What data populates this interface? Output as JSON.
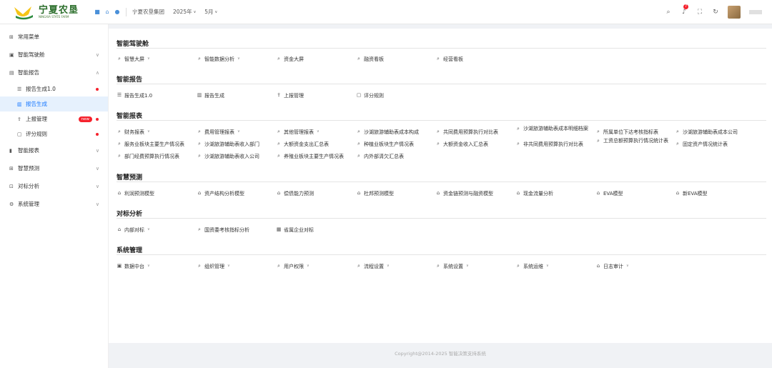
{
  "header": {
    "logo_title": "宁夏农垦",
    "logo_sub": "NINGXIA STATE FARM",
    "org": "宁夏农垦集团",
    "year": "2025年",
    "month": "5月",
    "notif_count": "7"
  },
  "sidebar": {
    "items": [
      {
        "label": "常用菜单",
        "icon": "grid-icon"
      },
      {
        "label": "智能驾驶舱",
        "icon": "cockpit-icon"
      },
      {
        "label": "智能报告",
        "icon": "report-icon"
      },
      {
        "label": "报告生成1.0",
        "icon": "list-icon"
      },
      {
        "label": "报告生成",
        "icon": "doc-icon"
      },
      {
        "label": "上报管理",
        "icon": "upload-icon",
        "badge": "new"
      },
      {
        "label": "评分规则",
        "icon": "rule-icon"
      },
      {
        "label": "智能报表",
        "icon": "chart-icon"
      },
      {
        "label": "智慧预测",
        "icon": "predict-icon"
      },
      {
        "label": "对标分析",
        "icon": "compare-icon"
      },
      {
        "label": "系统管理",
        "icon": "settings-icon"
      }
    ]
  },
  "sections": [
    {
      "title": "智能驾驶舱",
      "links": [
        "智慧大屏",
        "智能数据分析",
        "资金大屏",
        "融资看板",
        "经营看板"
      ]
    },
    {
      "title": "智能报告",
      "links": [
        "报告生成1.0",
        "报告生成",
        "上报管理",
        "评分规则"
      ]
    },
    {
      "title": "智能报表",
      "links": [
        "财务报表",
        "费用管理报表",
        "其他管理报表",
        "沙湖旅游辅助表成本构成",
        "共同费用预算执行对比表",
        "沙湖旅游辅助表成本明细档案",
        "所属单位下达考核指标表",
        "沙湖旅游辅助表成本公司",
        "服务业板块主要生产情况表",
        "沙湖旅游辅助表收入部门",
        "大额资金支出汇总表",
        "种植业板块生产情况表",
        "大额资金收入汇总表",
        "非共同费用预算执行对比表",
        "工资总额预算执行情况统计表",
        "固定资产情况统计表",
        "部门经费预算执行情况表",
        "沙湖旅游辅助表收入公司",
        "养殖业板块主要生产情况表",
        "内外部清欠汇总表"
      ]
    },
    {
      "title": "智慧预测",
      "links": [
        "利润预测模型",
        "资产结构分析模型",
        "偿债能力预测",
        "杜邦预测模型",
        "资金链预测与融资模型",
        "现金流量分析",
        "EVA模型",
        "新EVA模型"
      ]
    },
    {
      "title": "对标分析",
      "links": [
        "内部对标",
        "国资委考核指标分析",
        "省属企业对标"
      ]
    },
    {
      "title": "系统管理",
      "links": [
        "数据中台",
        "组织管理",
        "用户权限",
        "流程设置",
        "系统设置",
        "系统运维",
        "日志审计"
      ]
    }
  ],
  "footer": "Copyright@2014-2025 智能决策支持系统"
}
